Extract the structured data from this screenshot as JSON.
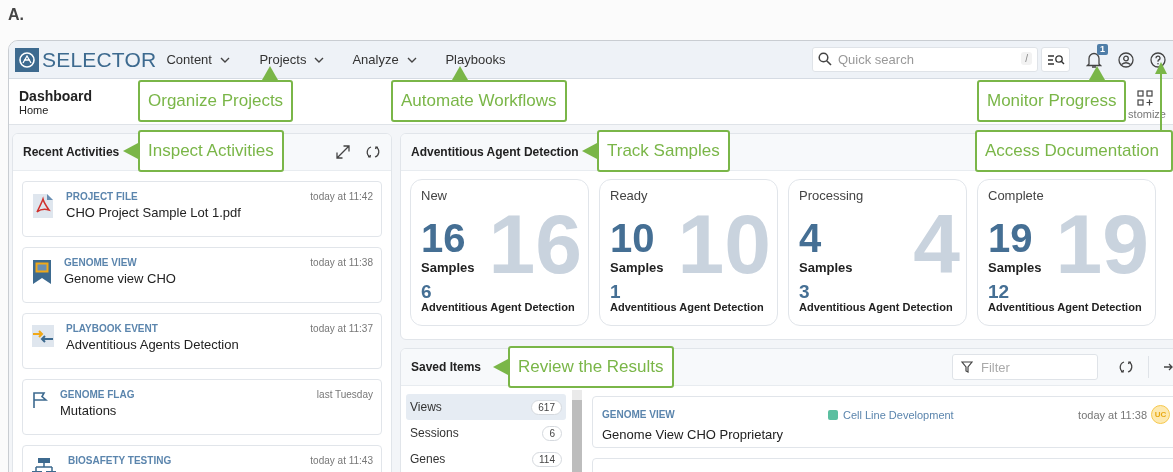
{
  "figure_label": "A.",
  "app": {
    "logo": "SELECTOR"
  },
  "nav": [
    {
      "label": "Content",
      "dropdown": true
    },
    {
      "label": "Projects",
      "dropdown": true
    },
    {
      "label": "Analyze",
      "dropdown": true
    },
    {
      "label": "Playbooks",
      "dropdown": false
    }
  ],
  "search": {
    "placeholder": "Quick search",
    "shortcut": "/"
  },
  "notifications": {
    "count": "1"
  },
  "header": {
    "title": "Dashboard",
    "breadcrumb": "Home",
    "customize_label": "stomize"
  },
  "recent": {
    "title": "Recent Activities",
    "items": [
      {
        "kind": "pdf",
        "type": "PROJECT FILE",
        "name": "CHO Project Sample Lot 1.pdf",
        "time": "today at 11:42"
      },
      {
        "kind": "view",
        "type": "GENOME VIEW",
        "name": "Genome view CHO",
        "time": "today at 11:38"
      },
      {
        "kind": "playbook",
        "type": "PLAYBOOK EVENT",
        "name": "Adventitious Agents Detection",
        "time": "today at 11:37"
      },
      {
        "kind": "flag",
        "type": "GENOME FLAG",
        "name": "Mutations",
        "time": "last Tuesday"
      },
      {
        "kind": "workflow",
        "type": "BIOSAFETY TESTING",
        "time": "today at 11:43"
      }
    ]
  },
  "samples": {
    "title": "Adventitious Agent Detection",
    "cards": [
      {
        "status": "New",
        "watermark": "16",
        "count": "16",
        "unit": "Samples",
        "sub_count": "6",
        "sub_label": "Adventitious Agent Detection"
      },
      {
        "status": "Ready",
        "watermark": "10",
        "count": "10",
        "unit": "Samples",
        "sub_count": "1",
        "sub_label": "Adventitious Agent Detection"
      },
      {
        "status": "Processing",
        "watermark": "4",
        "count": "4",
        "unit": "Samples",
        "sub_count": "3",
        "sub_label": "Adventitious Agent Detection"
      },
      {
        "status": "Complete",
        "watermark": "19",
        "count": "19",
        "unit": "Samples",
        "sub_count": "12",
        "sub_label": "Adventitious Agent Detection"
      }
    ]
  },
  "saved": {
    "title": "Saved Items",
    "filter_placeholder": "Filter",
    "categories": [
      {
        "label": "Views",
        "count": "617",
        "selected": true
      },
      {
        "label": "Sessions",
        "count": "6",
        "selected": false
      },
      {
        "label": "Genes",
        "count": "114",
        "selected": false
      }
    ],
    "items": [
      {
        "type": "GENOME VIEW",
        "tag": "Cell Line Development",
        "color": "#5bbfa0",
        "time": "today at 11:38",
        "name": "Genome View CHO Proprietary",
        "avatar": "UC"
      }
    ]
  },
  "callouts": [
    {
      "text": "Organize Projects",
      "kind": "up"
    },
    {
      "text": "Automate Workflows",
      "kind": "up"
    },
    {
      "text": "Monitor Progress",
      "kind": "up"
    },
    {
      "text": "Inspect Activities",
      "kind": "left"
    },
    {
      "text": "Track Samples",
      "kind": "left"
    },
    {
      "text": "Access Documentation",
      "kind": "line"
    },
    {
      "text": "Review the Results",
      "kind": "left"
    }
  ]
}
